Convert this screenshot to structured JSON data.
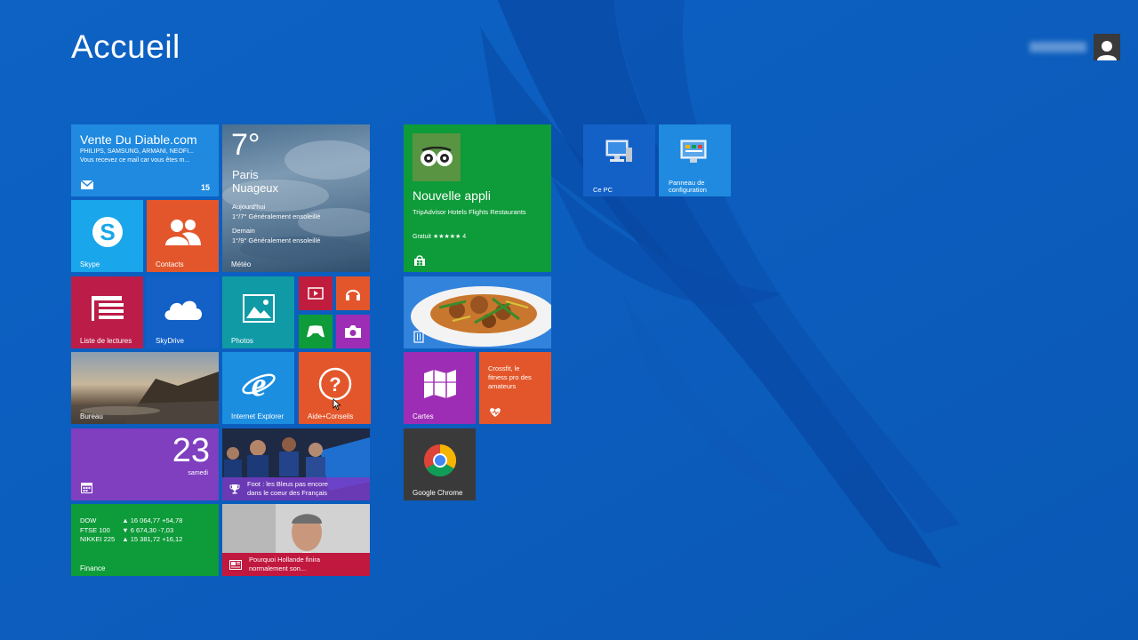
{
  "header": {
    "title": "Accueil"
  },
  "colors": {
    "background": "#0c5fc0",
    "accent": "#1f70d4"
  },
  "tiles": {
    "mail": {
      "title": "Vente Du Diable.com",
      "sub1": "PHILIPS, SAMSUNG, ARMANI, NEOFI...",
      "sub2": "Vous recevez ce mail car vous êtes m...",
      "count": "15",
      "icon": "mail-icon"
    },
    "weather": {
      "temp": "7°",
      "city": "Paris",
      "condition": "Nuageux",
      "today_label": "Aujourd'hui",
      "today_text": "1°/7° Généralement ensoleillé",
      "tomorrow_label": "Demain",
      "tomorrow_text": "1°/9° Généralement ensoleillé",
      "label": "Météo"
    },
    "skype": {
      "label": "Skype",
      "icon": "skype-icon"
    },
    "contacts": {
      "label": "Contacts",
      "icon": "people-icon"
    },
    "reading_list": {
      "label": "Liste de lectures",
      "icon": "reading-list-icon"
    },
    "skydrive": {
      "label": "SkyDrive",
      "icon": "cloud-icon"
    },
    "photos": {
      "label": "Photos",
      "icon": "photo-icon"
    },
    "video": {
      "icon": "video-icon"
    },
    "music": {
      "icon": "headphones-icon"
    },
    "games": {
      "icon": "xbox-icon"
    },
    "camera": {
      "icon": "camera-icon"
    },
    "desktop": {
      "label": "Bureau"
    },
    "ie": {
      "label": "Internet Explorer",
      "icon": "ie-icon"
    },
    "help": {
      "label": "Aide+Conseils",
      "icon": "question-icon"
    },
    "calendar": {
      "day": "23",
      "weekday": "samedi",
      "icon": "calendar-icon"
    },
    "sport": {
      "text1": "Foot : les Bleus pas encore",
      "text2": "dans le coeur des Français",
      "icon": "trophy-icon"
    },
    "finance": {
      "label": "Finance",
      "rows": [
        {
          "name": "DOW",
          "arrow": "▲",
          "value": "16 064,77",
          "change": "+54,78"
        },
        {
          "name": "FTSE 100",
          "arrow": "▼",
          "value": "6 674,30",
          "change": "-7,03"
        },
        {
          "name": "NIKKEI 225",
          "arrow": "▲",
          "value": "15 381,72",
          "change": "+16,12"
        }
      ]
    },
    "news": {
      "text1": "Pourquoi Hollande finira",
      "text2": "normalement son...",
      "icon": "news-icon"
    },
    "tripadvisor": {
      "title": "Nouvelle appli",
      "subtitle": "TripAdvisor Hotels Flights Restaurants",
      "rating": "Gratuit ★★★★★ 4",
      "icon": "store-icon"
    },
    "food": {
      "icon": "food-icon"
    },
    "maps": {
      "label": "Cartes",
      "icon": "map-icon"
    },
    "crossfit": {
      "line1": "Crossfit, le",
      "line2": "fitness pro des",
      "line3": "amateurs",
      "icon": "health-icon"
    },
    "chrome": {
      "label": "Google Chrome",
      "icon": "chrome-icon"
    },
    "this_pc": {
      "label": "Ce PC",
      "icon": "computer-icon"
    },
    "control_panel": {
      "label1": "Panneau de",
      "label2": "configuration",
      "icon": "control-panel-icon"
    }
  }
}
